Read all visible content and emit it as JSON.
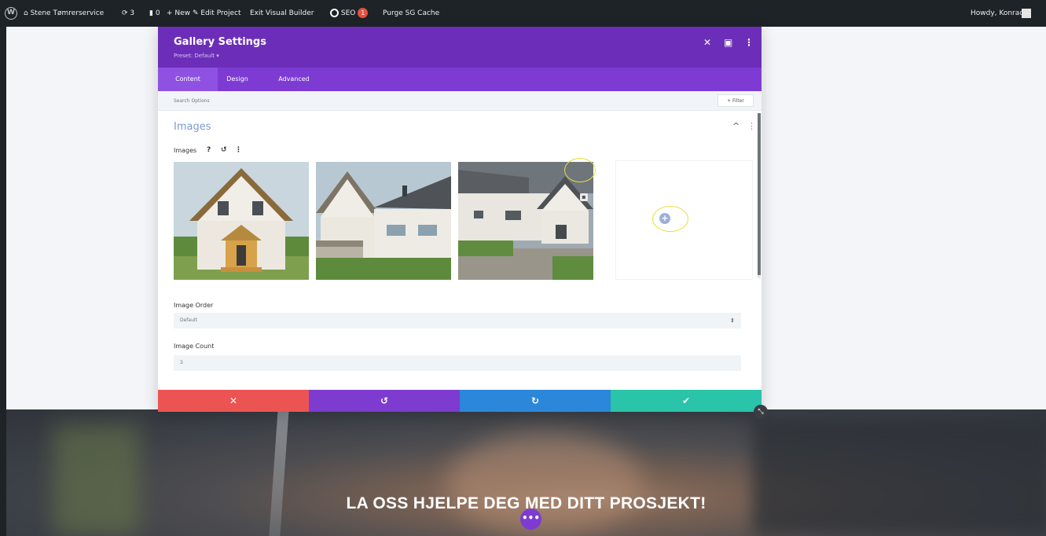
{
  "admin_bar": {
    "site_name": "Stene Tømrerservice",
    "updates_count": "3",
    "comments_count": "0",
    "new_label": "+ New",
    "edit_project_label": "Edit Project",
    "exit_builder_label": "Exit Visual Builder",
    "seo_label": "SEO",
    "seo_count": "1",
    "purge_label": "Purge SG Cache",
    "greeting": "Howdy, Konrad"
  },
  "modal": {
    "title": "Gallery Settings",
    "preset": "Preset: Default ▾",
    "tabs": [
      "Content",
      "Design",
      "Advanced"
    ],
    "active_tab": "Content",
    "search_placeholder": "Search Options",
    "filter_label": "+ Filter",
    "section_title": "Images",
    "images_label": "Images",
    "image_order_label": "Image Order",
    "image_order_value": "Default",
    "image_count_label": "Image Count",
    "image_count_value": "3"
  },
  "footer": {
    "colors": {
      "cancel": "#ec5453",
      "undo": "#7e3bd0",
      "redo": "#2b87da",
      "save": "#29c4a9"
    }
  },
  "hero": {
    "title": "LA OSS HJELPE DEG MED DITT PROSJEKT!"
  },
  "colors": {
    "header_purple": "#6c2eb9",
    "tabs_purple": "#7d3bd4",
    "admin_bar": "#1d2327",
    "annotation_yellow": "#e8de3b"
  }
}
